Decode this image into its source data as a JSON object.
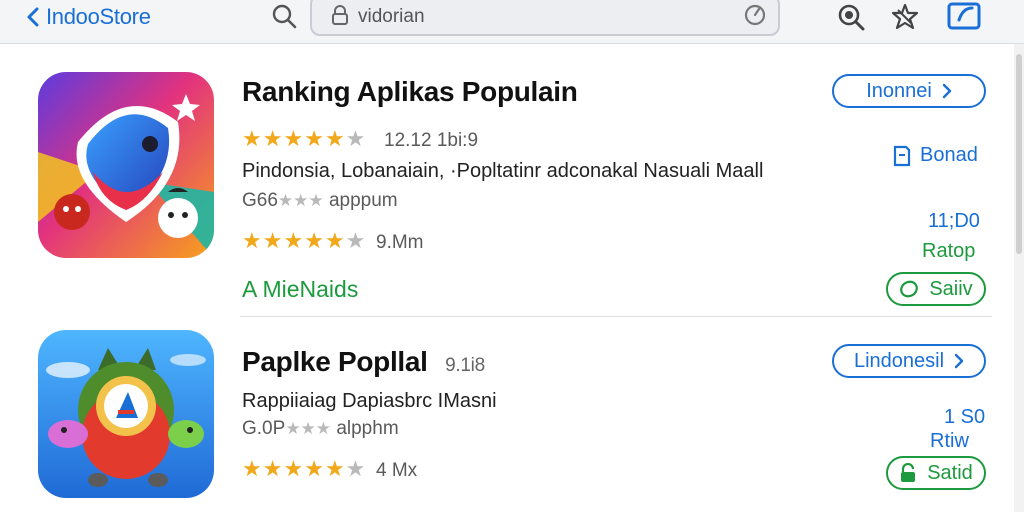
{
  "topbar": {
    "back_label": "IndooStore",
    "search_value": "vidorian",
    "search_placeholder": "vidorian"
  },
  "apps": [
    {
      "title": "Ranking Aplikas Populain",
      "rating_line": "12.12 1bi:9",
      "description": "Pindonsia, Lobanaiain, ·Popltatinr adconakal Nasuali Maall",
      "sub_rating_prefix": "G66",
      "sub_rating_suffix": "apppum",
      "rating2_text": "9.Mm",
      "tagline": "A MieNaids",
      "region_button": "Inonnei",
      "save_label": "Bonad",
      "time": "11;D0",
      "rating_word": "Ratop",
      "action_button": "Saiiv",
      "stars_main": 5,
      "stars_sub": 3
    },
    {
      "title": "Paplke Popllal",
      "title_suffix": "9.1i8",
      "description": "Rappiiaiag Dapiasbrc IMasni",
      "sub_rating_prefix": "G.0P",
      "sub_rating_suffix": "alpphm",
      "rating2_text": "4 Mx",
      "region_button": "Lindonesil",
      "count": "1 S0",
      "rating_word": "Rtiw",
      "action_button": "Satid",
      "stars_main": 5,
      "stars_sub": 3
    }
  ],
  "colors": {
    "accent_blue": "#1a6fd6",
    "accent_green": "#1d9a3d",
    "star_gold": "#f1a81b"
  }
}
